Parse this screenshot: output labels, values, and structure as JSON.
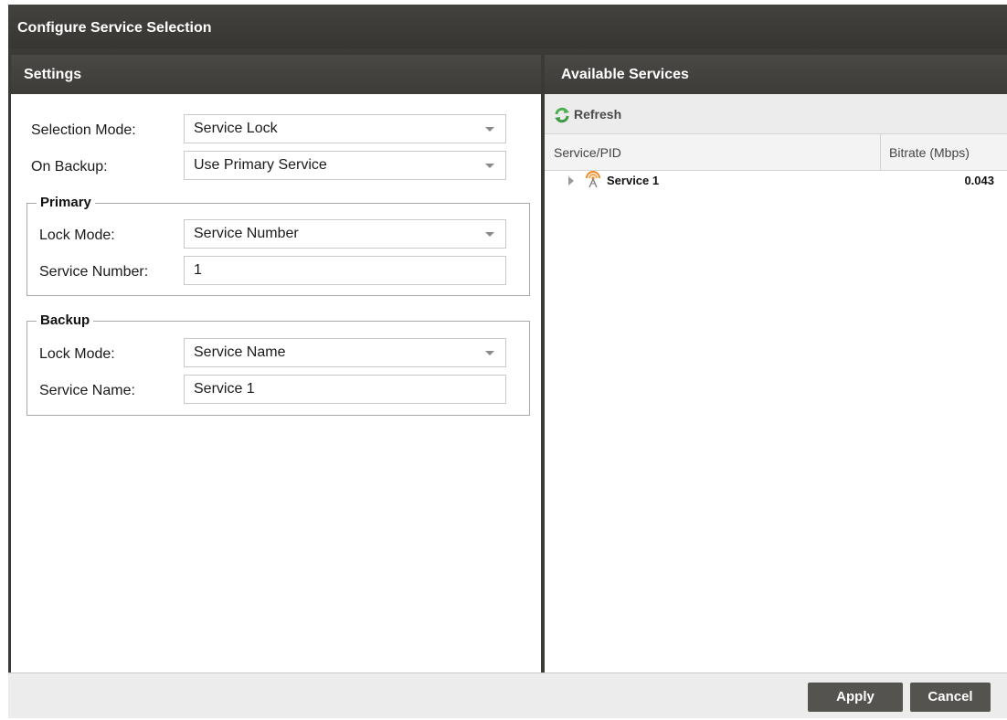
{
  "dialog": {
    "title": "Configure Service Selection"
  },
  "settings": {
    "header": "Settings",
    "selection_mode": {
      "label": "Selection Mode:",
      "value": "Service Lock"
    },
    "on_backup": {
      "label": "On Backup:",
      "value": "Use Primary Service"
    },
    "primary": {
      "legend": "Primary",
      "lock_mode": {
        "label": "Lock Mode:",
        "value": "Service Number"
      },
      "service_number": {
        "label": "Service Number:",
        "value": "1"
      }
    },
    "backup": {
      "legend": "Backup",
      "lock_mode": {
        "label": "Lock Mode:",
        "value": "Service Name"
      },
      "service_name": {
        "label": "Service Name:",
        "value": "Service 1"
      }
    }
  },
  "available_services": {
    "header": "Available Services",
    "refresh_label": "Refresh",
    "columns": [
      "Service/PID",
      "Bitrate (Mbps)"
    ],
    "rows": [
      {
        "name": "Service 1",
        "bitrate": "0.043",
        "icon": "broadcast-tower-icon"
      }
    ]
  },
  "footer": {
    "apply_label": "Apply",
    "cancel_label": "Cancel"
  },
  "colors": {
    "titlebar": "#3c3a37",
    "button": "#555350",
    "refresh_icon": "#4caf50",
    "service_icon": "#f08a24"
  }
}
